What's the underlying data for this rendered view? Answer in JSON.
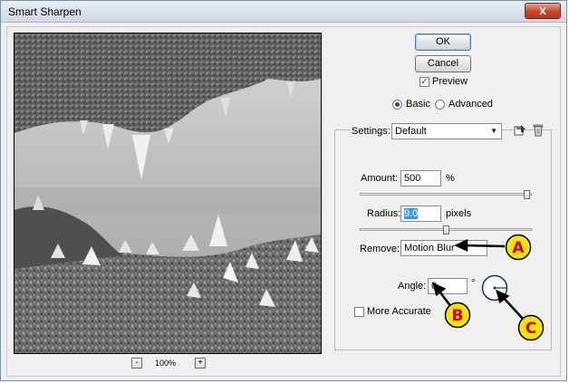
{
  "window": {
    "title": "Smart Sharpen",
    "close_glyph": "x"
  },
  "buttons": {
    "ok": "OK",
    "cancel": "Cancel"
  },
  "preview_checkbox": {
    "label": "Preview",
    "checked": true
  },
  "mode": {
    "basic": "Basic",
    "advanced": "Advanced",
    "selected": "Basic"
  },
  "settings": {
    "label": "Settings:",
    "value": "Default"
  },
  "amount": {
    "label": "Amount:",
    "value": "500",
    "unit": "%",
    "slider_fraction": 0.99
  },
  "radius": {
    "label": "Radius:",
    "value": "9.0",
    "unit": "pixels",
    "slider_fraction": 0.5
  },
  "remove": {
    "label": "Remove:",
    "value": "Motion Blur"
  },
  "angle": {
    "label": "Angle:",
    "value": "0",
    "unit": "°"
  },
  "more_accurate": {
    "label": "More Accurate",
    "checked": false
  },
  "zoom": {
    "minus": "-",
    "plus": "+",
    "level": "100%"
  },
  "annotations": {
    "a": "A",
    "b": "B",
    "c": "C",
    "color": "#f5e400",
    "letter_color": "#cc0000"
  },
  "icons": {
    "save_settings": "save-settings-icon",
    "delete_settings": "trash-icon"
  }
}
